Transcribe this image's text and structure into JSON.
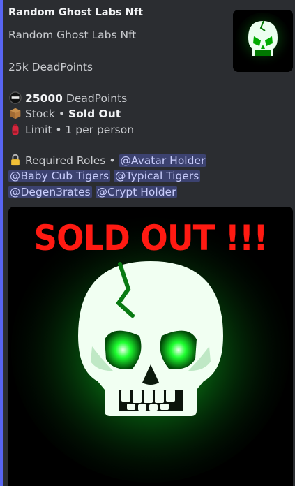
{
  "embed": {
    "accent_color": "#5865f2",
    "author": "Random Ghost Labs Nft",
    "title": "Random Ghost Labs Nft",
    "price_line": "25k DeadPoints",
    "price": {
      "icon": "dvp-coin-icon",
      "amount": "25000",
      "unit": "DeadPoints"
    },
    "stock": {
      "icon": "package-icon",
      "label": "Stock",
      "sep": "•",
      "value": "Sold Out"
    },
    "limit": {
      "icon": "backpack-icon",
      "label": "Limit",
      "sep": "•",
      "value": "1 per person"
    },
    "roles": {
      "icon": "lock-icon",
      "label": "Required Roles",
      "sep": "•",
      "mentions": [
        "@Avatar Holder",
        "@Baby Cub Tigers",
        "@Typical Tigers",
        "@Degen3rates",
        "@Crypt Holder"
      ]
    },
    "image": {
      "overlay_text": "SOLD OUT !!!",
      "text_color": "#ff1a12",
      "glow_color": "#19ff2a"
    }
  }
}
